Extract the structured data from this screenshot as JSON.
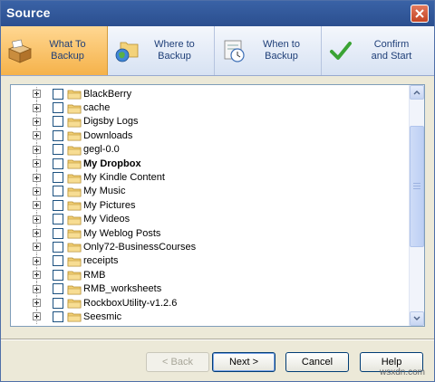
{
  "window": {
    "title": "Source"
  },
  "tabs": [
    {
      "label": "What To\nBackup",
      "icon": "backup-box-icon",
      "active": true
    },
    {
      "label": "Where to\nBackup",
      "icon": "globe-folder-icon",
      "active": false
    },
    {
      "label": "When to\nBackup",
      "icon": "calendar-clock-icon",
      "active": false
    },
    {
      "label": "Confirm\nand Start",
      "icon": "checkmark-icon",
      "active": false
    }
  ],
  "tree": {
    "items": [
      {
        "label": "BlackBerry",
        "bold": false
      },
      {
        "label": "cache",
        "bold": false
      },
      {
        "label": "Digsby Logs",
        "bold": false
      },
      {
        "label": "Downloads",
        "bold": false
      },
      {
        "label": "gegl-0.0",
        "bold": false
      },
      {
        "label": "My Dropbox",
        "bold": true
      },
      {
        "label": "My Kindle Content",
        "bold": false
      },
      {
        "label": "My Music",
        "bold": false
      },
      {
        "label": "My Pictures",
        "bold": false
      },
      {
        "label": "My Videos",
        "bold": false
      },
      {
        "label": "My Weblog Posts",
        "bold": false
      },
      {
        "label": "Only72-BusinessCourses",
        "bold": false
      },
      {
        "label": "receipts",
        "bold": false
      },
      {
        "label": "RMB",
        "bold": false
      },
      {
        "label": "RMB_worksheets",
        "bold": false
      },
      {
        "label": "RockboxUtility-v1.2.6",
        "bold": false
      },
      {
        "label": "Seesmic",
        "bold": false
      }
    ]
  },
  "buttons": {
    "back": "< Back",
    "next": "Next >",
    "cancel": "Cancel",
    "help": "Help"
  },
  "watermark": "wsxdn.com",
  "colors": {
    "title_bar": "#2b4f8f",
    "active_tab": "#f5b24a"
  }
}
